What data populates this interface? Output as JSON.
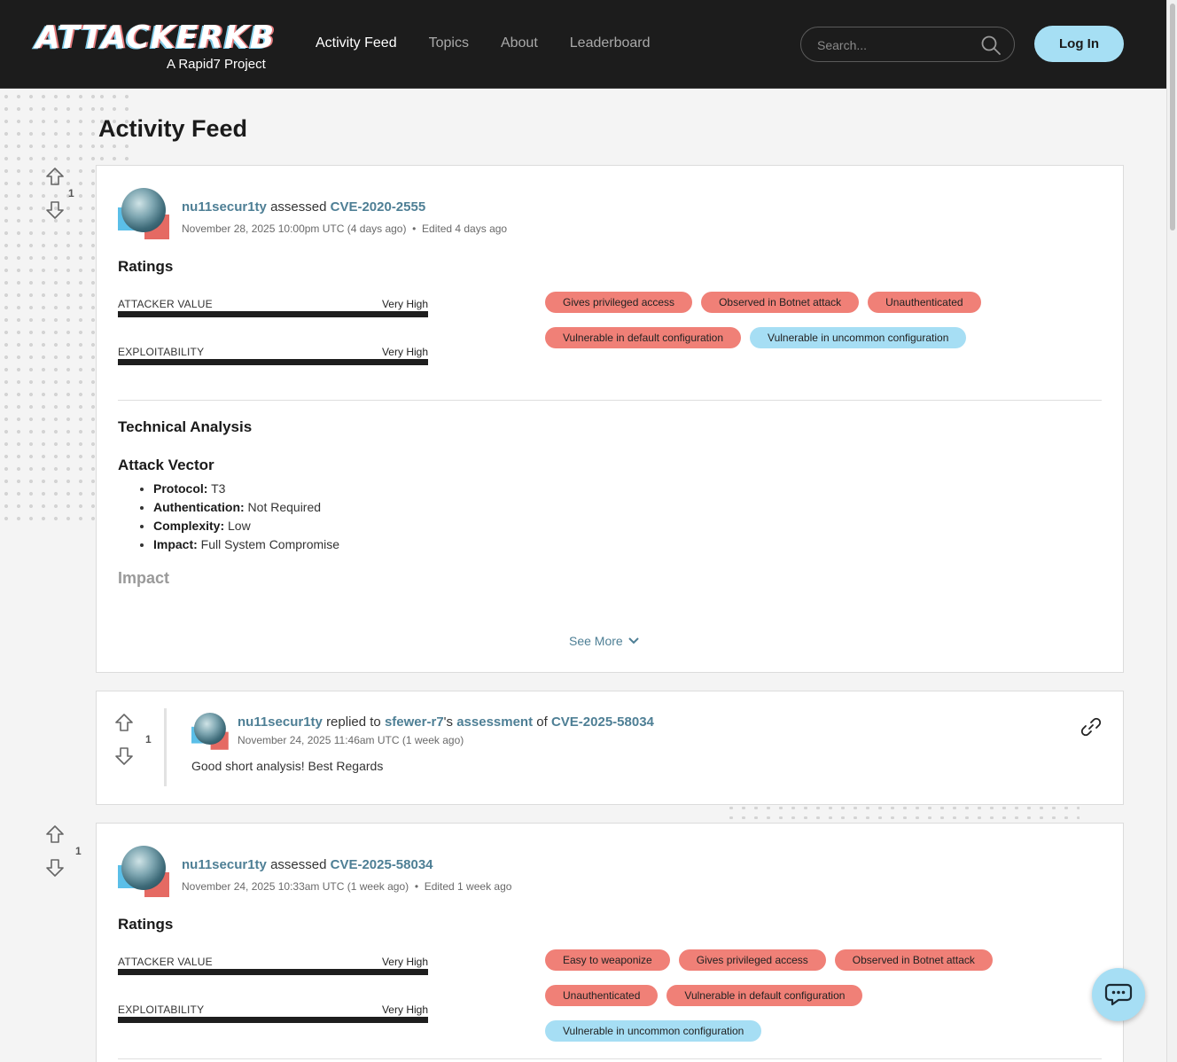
{
  "header": {
    "logo_text": "ATTACKERKB",
    "logo_sub": "A Rapid7 Project",
    "nav": [
      "Activity Feed",
      "Topics",
      "About",
      "Leaderboard"
    ],
    "search_placeholder": "Search...",
    "login_label": "Log In"
  },
  "page_title": "Activity Feed",
  "feed": [
    {
      "votes": "1",
      "user": "nu11secur1ty",
      "verb": "assessed",
      "cve": "CVE-2020-2555",
      "date": "November 28, 2025 10:00pm UTC (4 days ago)",
      "edited": "Edited 4 days ago",
      "ratings_title": "Ratings",
      "ratings": [
        {
          "label": "ATTACKER VALUE",
          "value": "Very High"
        },
        {
          "label": "EXPLOITABILITY",
          "value": "Very High"
        }
      ],
      "tags": [
        {
          "text": "Gives privileged access",
          "color": "red"
        },
        {
          "text": "Observed in Botnet attack",
          "color": "red"
        },
        {
          "text": "Unauthenticated",
          "color": "red"
        },
        {
          "text": "Vulnerable in default configuration",
          "color": "red"
        },
        {
          "text": "Vulnerable in uncommon configuration",
          "color": "blue"
        }
      ],
      "technical_title": "Technical Analysis",
      "attack_vector_title": "Attack Vector",
      "attack_vector": [
        {
          "key": "Protocol:",
          "value": " T3"
        },
        {
          "key": "Authentication:",
          "value": " Not Required"
        },
        {
          "key": "Complexity:",
          "value": " Low"
        },
        {
          "key": "Impact:",
          "value": " Full System Compromise"
        }
      ],
      "impact_title": "Impact",
      "see_more": "See More"
    },
    {
      "votes": "1",
      "user": "nu11secur1ty",
      "verb": "replied to",
      "target_user": "sfewer-r7",
      "possessive": "'s",
      "assessment_word": "assessment",
      "of_word": "of",
      "cve": "CVE-2025-58034",
      "date": "November 24, 2025 11:46am UTC (1 week ago)",
      "body": "Good short analysis! Best Regards"
    },
    {
      "votes": "1",
      "user": "nu11secur1ty",
      "verb": "assessed",
      "cve": "CVE-2025-58034",
      "date": "November 24, 2025 10:33am UTC (1 week ago)",
      "edited": "Edited 1 week ago",
      "ratings_title": "Ratings",
      "ratings": [
        {
          "label": "ATTACKER VALUE",
          "value": "Very High"
        },
        {
          "label": "EXPLOITABILITY",
          "value": "Very High"
        }
      ],
      "tags": [
        {
          "text": "Easy to weaponize",
          "color": "red"
        },
        {
          "text": "Gives privileged access",
          "color": "red"
        },
        {
          "text": "Observed in Botnet attack",
          "color": "red"
        },
        {
          "text": "Unauthenticated",
          "color": "red"
        },
        {
          "text": "Vulnerable in default configuration",
          "color": "red"
        },
        {
          "text": "Vulnerable in uncommon configuration",
          "color": "blue"
        }
      ]
    }
  ],
  "colors": {
    "header_bg": "#1c1c1c",
    "link": "#4e7f95",
    "tag_red": "#f08077",
    "tag_blue": "#a6def4",
    "login_bg": "#a6dff4"
  },
  "icons": [
    "search-icon",
    "upvote-icon",
    "downvote-icon",
    "chevron-down-icon",
    "link-icon",
    "chat-icon"
  ]
}
